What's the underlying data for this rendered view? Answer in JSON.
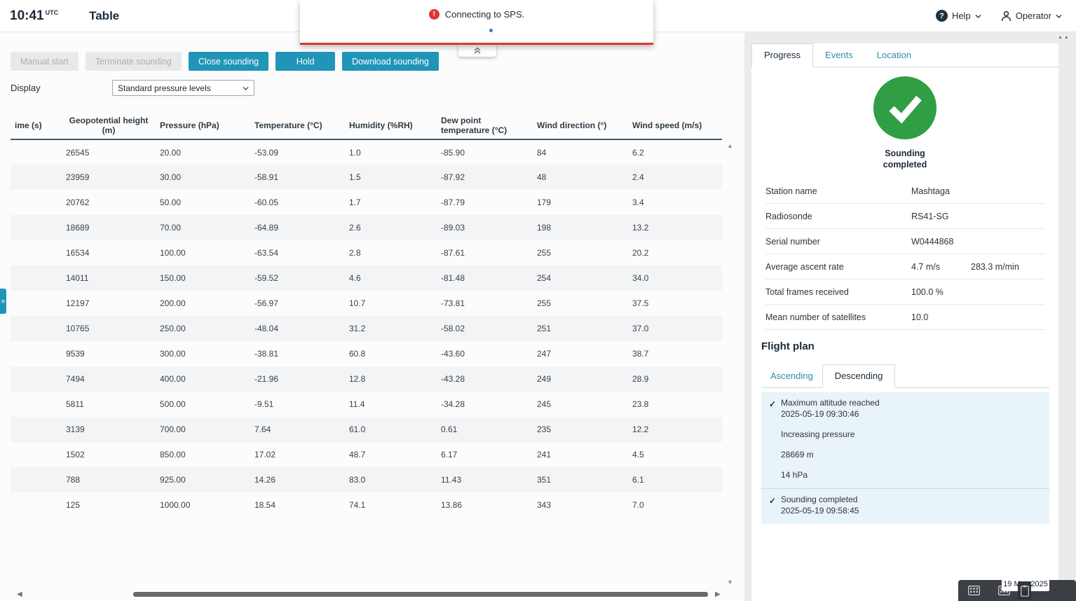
{
  "colors": {
    "accent_teal": "#2095b7",
    "navy_text": "#1c2b39",
    "error_red": "#da392e",
    "success_green": "#2f9e44",
    "event_bg": "#e9f3fa"
  },
  "header": {
    "time": "10:41",
    "time_suffix": "UTC",
    "page_title": "Table",
    "help_label": "Help",
    "operator_label": "Operator"
  },
  "notification": {
    "message": "Connecting to SPS."
  },
  "toolbar": {
    "buttons": [
      {
        "label": "Manual start",
        "enabled": false
      },
      {
        "label": "Terminate sounding",
        "enabled": false
      },
      {
        "label": "Close sounding",
        "enabled": true
      },
      {
        "label": "Hold",
        "enabled": true
      },
      {
        "label": "Download sounding",
        "enabled": true
      }
    ],
    "display_label": "Display",
    "display_value": "Standard pressure levels"
  },
  "table": {
    "columns": [
      "ime (s)",
      "Geopotential height (m)",
      "Pressure (hPa)",
      "Temperature (°C)",
      "Humidity (%RH)",
      "Dew point temperature (°C)",
      "Wind direction (°)",
      "Wind speed (m/s)"
    ],
    "rows": [
      [
        "",
        "26545",
        "20.00",
        "-53.09",
        "1.0",
        "-85.90",
        "84",
        "6.2"
      ],
      [
        "",
        "23959",
        "30.00",
        "-58.91",
        "1.5",
        "-87.92",
        "48",
        "2.4"
      ],
      [
        "",
        "20762",
        "50.00",
        "-60.05",
        "1.7",
        "-87.79",
        "179",
        "3.4"
      ],
      [
        "",
        "18689",
        "70.00",
        "-64.89",
        "2.6",
        "-89.03",
        "198",
        "13.2"
      ],
      [
        "",
        "16534",
        "100.00",
        "-63.54",
        "2.8",
        "-87.61",
        "255",
        "20.2"
      ],
      [
        "",
        "14011",
        "150.00",
        "-59.52",
        "4.6",
        "-81.48",
        "254",
        "34.0"
      ],
      [
        "",
        "12197",
        "200.00",
        "-56.97",
        "10.7",
        "-73.81",
        "255",
        "37.5"
      ],
      [
        "",
        "10765",
        "250.00",
        "-48.04",
        "31.2",
        "-58.02",
        "251",
        "37.0"
      ],
      [
        "",
        "9539",
        "300.00",
        "-38.81",
        "60.8",
        "-43.60",
        "247",
        "38.7"
      ],
      [
        "",
        "7494",
        "400.00",
        "-21.96",
        "12.8",
        "-43.28",
        "249",
        "28.9"
      ],
      [
        "",
        "5811",
        "500.00",
        "-9.51",
        "11.4",
        "-34.28",
        "245",
        "23.8"
      ],
      [
        "",
        "3139",
        "700.00",
        "7.64",
        "61.0",
        "0.61",
        "235",
        "12.2"
      ],
      [
        "",
        "1502",
        "850.00",
        "17.02",
        "48.7",
        "6.17",
        "241",
        "4.5"
      ],
      [
        "",
        "788",
        "925.00",
        "14.26",
        "83.0",
        "11.43",
        "351",
        "6.1"
      ],
      [
        "",
        "125",
        "1000.00",
        "18.54",
        "74.1",
        "13.86",
        "343",
        "7.0"
      ]
    ]
  },
  "panel": {
    "tabs": [
      {
        "label": "Progress",
        "active": true
      },
      {
        "label": "Events",
        "active": false
      },
      {
        "label": "Location",
        "active": false
      }
    ],
    "status": "Sounding completed",
    "info": [
      {
        "label": "Station name",
        "value": "Mashtaga"
      },
      {
        "label": "Radiosonde",
        "value": "RS41-SG"
      },
      {
        "label": "Serial number",
        "value": "W0444868"
      },
      {
        "label": "Average ascent rate",
        "value": "4.7 m/s",
        "value2": "283.3 m/min"
      },
      {
        "label": "Total frames received",
        "value": "100.0 %"
      },
      {
        "label": "Mean number of satellites",
        "value": "10.0"
      }
    ],
    "flight_plan": {
      "title": "Flight plan",
      "tabs": [
        {
          "label": "Ascending",
          "active": false
        },
        {
          "label": "Descending",
          "active": true
        }
      ],
      "events": [
        {
          "checked": true,
          "title": "Maximum altitude reached",
          "timestamp": "2025-05-19 09:30:46",
          "details": [
            "Increasing pressure",
            "28669 m",
            "14 hPa"
          ]
        },
        {
          "checked": true,
          "title": "Sounding completed",
          "timestamp": "2025-05-19 09:58:45",
          "details": []
        }
      ]
    }
  },
  "overlay": {
    "date": "19 May 2025"
  }
}
